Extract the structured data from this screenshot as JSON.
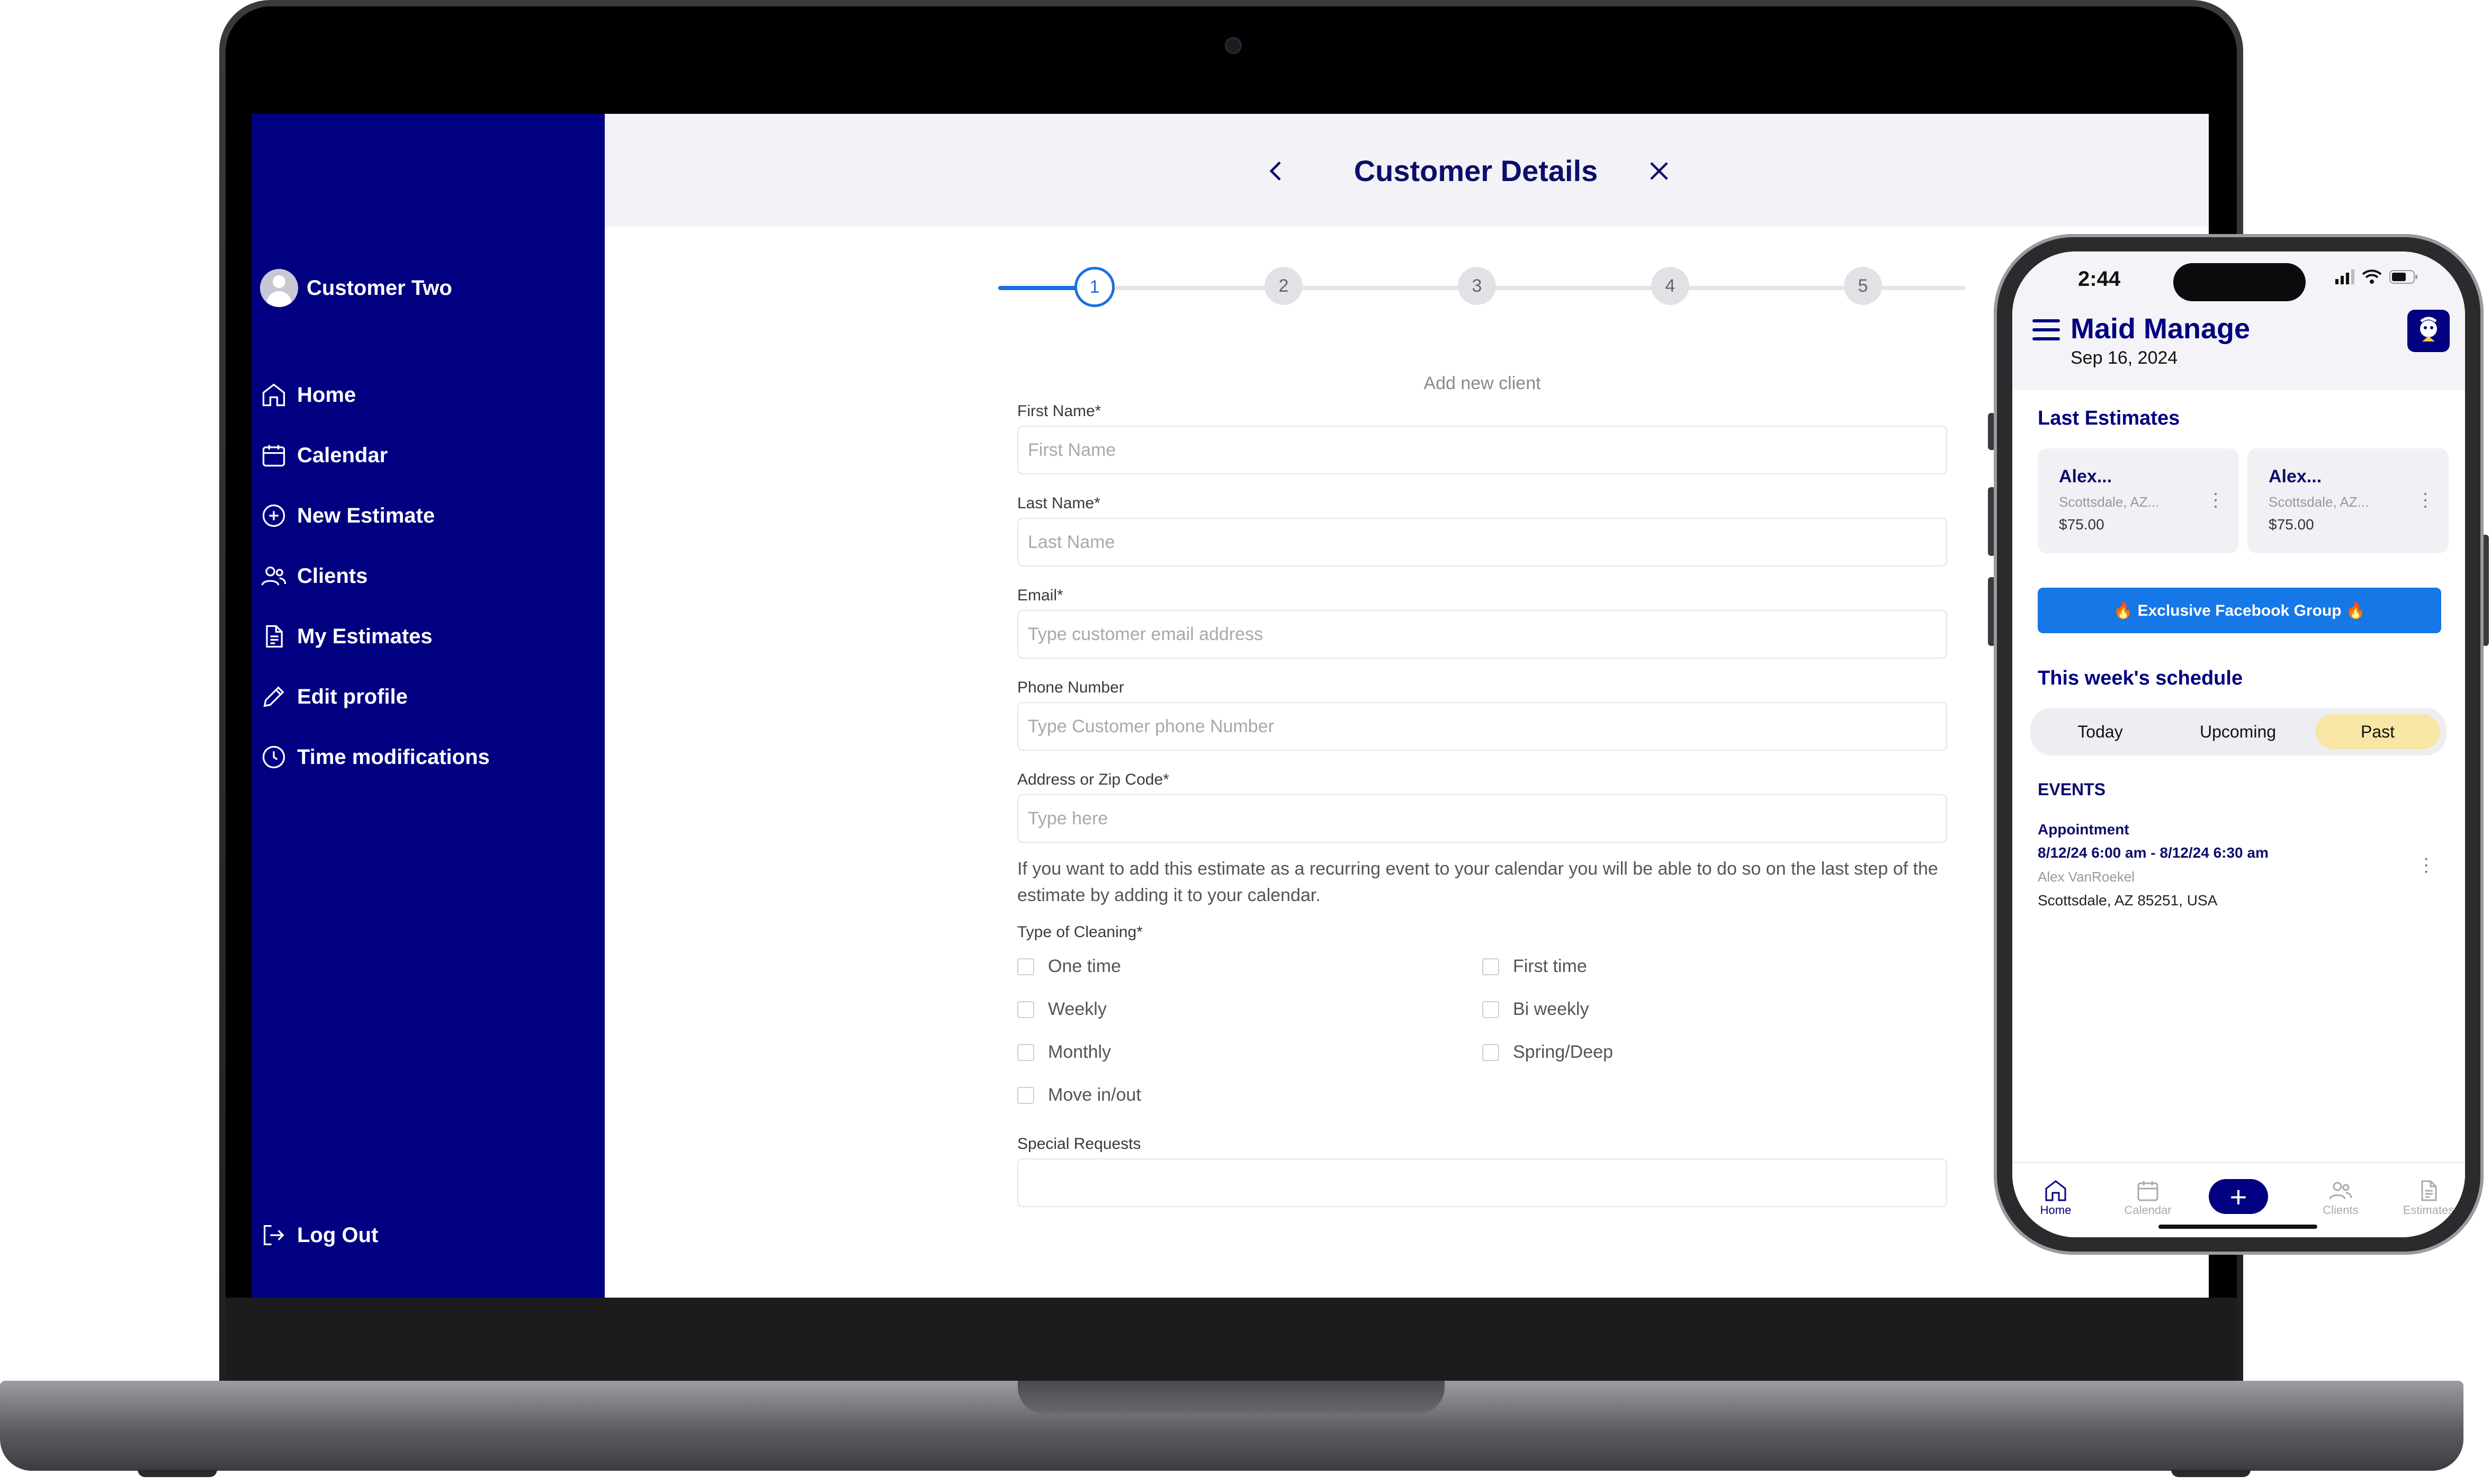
{
  "laptop": {
    "sidebar": {
      "user_name": "Customer Two",
      "items": [
        {
          "label": "Home",
          "icon": "home-icon"
        },
        {
          "label": "Calendar",
          "icon": "calendar-icon"
        },
        {
          "label": "New Estimate",
          "icon": "plus-circle-icon"
        },
        {
          "label": "Clients",
          "icon": "users-icon"
        },
        {
          "label": "My Estimates",
          "icon": "document-icon"
        },
        {
          "label": "Edit profile",
          "icon": "pencil-icon"
        },
        {
          "label": "Time modifications",
          "icon": "clock-icon"
        }
      ],
      "logout_label": "Log Out"
    },
    "header": {
      "title": "Customer Details"
    },
    "stepper": {
      "steps": [
        "1",
        "2",
        "3",
        "4",
        "5"
      ],
      "current": 1
    },
    "form": {
      "caption": "Add new client",
      "first_name": {
        "label": "First Name*",
        "placeholder": "First Name",
        "value": ""
      },
      "last_name": {
        "label": "Last Name*",
        "placeholder": "Last Name",
        "value": ""
      },
      "email": {
        "label": "Email*",
        "placeholder": "Type customer email address",
        "value": ""
      },
      "phone": {
        "label": "Phone Number",
        "placeholder": "Type Customer phone Number",
        "value": ""
      },
      "address": {
        "label": "Address or Zip Code*",
        "placeholder": "Type here",
        "value": ""
      },
      "note": "If you want to add this estimate as a recurring event to your calendar you will be able to do so on the last step of the estimate by adding it to your calendar.",
      "cleaning_label": "Type of Cleaning*",
      "cleaning_options": [
        "One time",
        "First time",
        "Weekly",
        "Bi weekly",
        "Monthly",
        "Spring/Deep",
        "Move in/out"
      ],
      "special_label": "Special Requests"
    }
  },
  "phone": {
    "time": "2:44",
    "app_title": "Maid Manage",
    "date": "Sep 16, 2024",
    "last_estimates_title": "Last Estimates",
    "estimates": [
      {
        "name": "Alex...",
        "address": "Scottsdale, AZ...",
        "price": "$75.00"
      },
      {
        "name": "Alex...",
        "address": "Scottsdale, AZ...",
        "price": "$75.00"
      }
    ],
    "facebook_button": "🔥 Exclusive Facebook Group 🔥",
    "schedule_title": "This week's schedule",
    "segments": [
      "Today",
      "Upcoming",
      "Past"
    ],
    "active_segment": "Past",
    "events_title": "EVENTS",
    "event": {
      "title": "Appointment",
      "time": "8/12/24 6:00 am - 8/12/24 6:30 am",
      "client": "Alex VanRoekel",
      "address": "Scottsdale, AZ 85251, USA"
    },
    "tabs": [
      "Home",
      "Calendar",
      "Clients",
      "Estimates"
    ],
    "active_tab": "Home"
  },
  "colors": {
    "brand": "#000080",
    "accent": "#1a6fe0",
    "facebook": "#1677e6",
    "segment_active": "#f8e6a4"
  }
}
